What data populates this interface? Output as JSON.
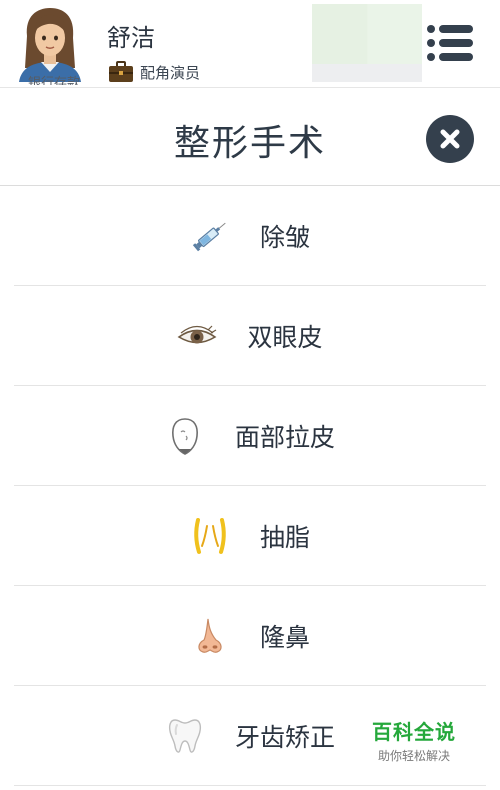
{
  "header": {
    "profile_name": "舒洁",
    "profile_role": "配角演员",
    "banner_text": "银行存款",
    "avatar_icon": "woman-avatar-icon",
    "role_icon": "briefcase-icon",
    "menu_icon": "hamburger-menu-icon"
  },
  "title_bar": {
    "title": "整形手术",
    "close_icon": "close-icon"
  },
  "procedures": [
    {
      "label": "除皱",
      "icon": "syringe-icon"
    },
    {
      "label": "双眼皮",
      "icon": "eye-icon"
    },
    {
      "label": "面部拉皮",
      "icon": "face-outline-icon"
    },
    {
      "label": "抽脂",
      "icon": "liposuction-icon"
    },
    {
      "label": "隆鼻",
      "icon": "nose-icon"
    },
    {
      "label": "牙齿矫正",
      "icon": "tooth-icon"
    }
  ],
  "watermark": {
    "title": "百科全说",
    "subtitle": "助你轻松解决"
  },
  "colors": {
    "text_dark": "#2b3440",
    "close_button_bg": "#34404d",
    "watermark_green": "#25a83b",
    "divider": "#e4e4e4"
  }
}
